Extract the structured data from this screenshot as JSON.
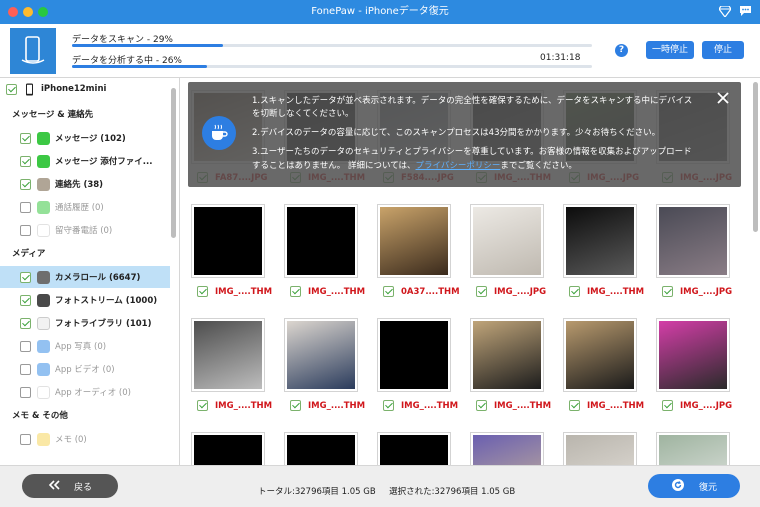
{
  "window": {
    "title": "FonePaw - iPhoneデータ復元",
    "icons": [
      "diamond-icon",
      "chat-icon"
    ]
  },
  "scan": {
    "scan_label": "データをスキャン - 29%",
    "scan_progress": 0.29,
    "analyze_label": "データを分析する中 - 26%",
    "analyze_progress": 0.26,
    "elapsed": "01:31:18",
    "help": "?",
    "pause_label": "一時停止",
    "stop_label": "停止"
  },
  "sidebar": {
    "device": "iPhone12mini",
    "sections": [
      {
        "title": "メッセージ & 連絡先",
        "items": [
          {
            "label": "メッセージ (102)",
            "checked": true,
            "enabled": true,
            "icon": "message-icon",
            "color": "#3cc844"
          },
          {
            "label": "メッセージ 添付ファイ...",
            "checked": true,
            "enabled": true,
            "icon": "attachment-icon",
            "color": "#3cc844"
          },
          {
            "label": "連絡先 (38)",
            "checked": true,
            "enabled": true,
            "icon": "contacts-icon",
            "color": "#b0a596"
          },
          {
            "label": "通話履歴 (0)",
            "checked": false,
            "enabled": false,
            "icon": "phone-icon",
            "color": "#3cc844"
          },
          {
            "label": "留守番電話 (0)",
            "checked": false,
            "enabled": false,
            "icon": "voicemail-icon",
            "color": "#ffffff"
          }
        ]
      },
      {
        "title": "メディア",
        "items": [
          {
            "label": "カメラロール (6647)",
            "checked": true,
            "enabled": true,
            "icon": "camera-icon",
            "color": "#6e6e6e",
            "selected": true
          },
          {
            "label": "フォトストリーム (1000)",
            "checked": true,
            "enabled": true,
            "icon": "photostream-icon",
            "color": "#4a4a4a"
          },
          {
            "label": "フォトライブラリ (101)",
            "checked": true,
            "enabled": true,
            "icon": "photos-icon",
            "color": "#f2f2f2"
          },
          {
            "label": "App 写真 (0)",
            "checked": false,
            "enabled": false,
            "icon": "app-photo-icon",
            "color": "#3a8ee6"
          },
          {
            "label": "App ビデオ (0)",
            "checked": false,
            "enabled": false,
            "icon": "app-video-icon",
            "color": "#3a8ee6"
          },
          {
            "label": "App オーディオ (0)",
            "checked": false,
            "enabled": false,
            "icon": "app-audio-icon",
            "color": "#ffffff"
          }
        ]
      },
      {
        "title": "メモ & その他",
        "items": [
          {
            "label": "メモ (0)",
            "checked": false,
            "enabled": false,
            "icon": "notes-icon",
            "color": "#f6d55c"
          }
        ]
      }
    ]
  },
  "tooltip": {
    "line1": "1.スキャンしたデータが並べ表示されます。データの完全性を確保するために、データをスキャンする中にデバイス",
    "line1b": "を切断しなくてください。",
    "line2": "2.デバイスのデータの容量に応じて、このスキャンプロセスは43分間をかかります。少々お待ちください。",
    "line3": "3.ユーザーたちのデータのセキュリティとプライバシーを尊重しています。お客様の情報を収集およびアップロード",
    "line4a": "することはありません。 詳細については、",
    "line4_link": "プライバシーポリシー",
    "line4b": "までご覧ください。"
  },
  "grid": {
    "rows": [
      [
        {
          "name": "FA87....JPG",
          "tone": [
            "#6b5a4a",
            "#c9c2b6"
          ]
        },
        {
          "name": "IMG_....THM",
          "tone": [
            "#1c1c1c",
            "#3a3a3a"
          ]
        },
        {
          "name": "F584....JPG",
          "tone": [
            "#7a7f85",
            "#b3b8bc"
          ]
        },
        {
          "name": "IMG_....THM",
          "tone": [
            "#2c2c2c",
            "#595959"
          ]
        },
        {
          "name": "IMG_....JPG",
          "tone": [
            "#4e6b3a",
            "#2c2c2c"
          ]
        },
        {
          "name": "IMG_....JPG",
          "tone": [
            "#3c3c3c",
            "#6a6a6a"
          ]
        }
      ],
      [
        {
          "name": "IMG_....THM",
          "tone": [
            "#000000",
            "#000000"
          ]
        },
        {
          "name": "IMG_....THM",
          "tone": [
            "#000000",
            "#000000"
          ]
        },
        {
          "name": "0A37....THM",
          "tone": [
            "#c9a36a",
            "#3a2a1c"
          ]
        },
        {
          "name": "IMG_....JPG",
          "tone": [
            "#ece9e4",
            "#bfb9b0"
          ]
        },
        {
          "name": "IMG_....THM",
          "tone": [
            "#0c0c0c",
            "#5a5a5a"
          ]
        },
        {
          "name": "IMG_....JPG",
          "tone": [
            "#4a4a55",
            "#8a7d86"
          ]
        }
      ],
      [
        {
          "name": "IMG_....THM",
          "tone": [
            "#4d4d4d",
            "#bdbdbd"
          ]
        },
        {
          "name": "IMG_....THM",
          "tone": [
            "#dcd6cf",
            "#2a3b5c"
          ]
        },
        {
          "name": "IMG_....THM",
          "tone": [
            "#000000",
            "#000000"
          ]
        },
        {
          "name": "IMG_....THM",
          "tone": [
            "#c0a57a",
            "#1c1c1c"
          ]
        },
        {
          "name": "IMG_....THM",
          "tone": [
            "#b89a6e",
            "#1a1a1a"
          ]
        },
        {
          "name": "IMG_....JPG",
          "tone": [
            "#d43ea8",
            "#2a2a2a"
          ]
        }
      ],
      [
        {
          "name": "",
          "tone": [
            "#000000",
            "#000000"
          ]
        },
        {
          "name": "",
          "tone": [
            "#000000",
            "#000000"
          ]
        },
        {
          "name": "",
          "tone": [
            "#000000",
            "#000000"
          ]
        },
        {
          "name": "",
          "tone": [
            "#6a5fb0",
            "#c9b59a"
          ]
        },
        {
          "name": "",
          "tone": [
            "#b9b5ad",
            "#e6e2dc"
          ]
        },
        {
          "name": "",
          "tone": [
            "#9fb4a0",
            "#e3e6e3"
          ]
        }
      ]
    ]
  },
  "footer": {
    "back_label": "戻る",
    "total": "トータル:32796項目 1.05 GB",
    "selected": "選択された:32796項目 1.05 GB",
    "recover_label": "復元"
  }
}
